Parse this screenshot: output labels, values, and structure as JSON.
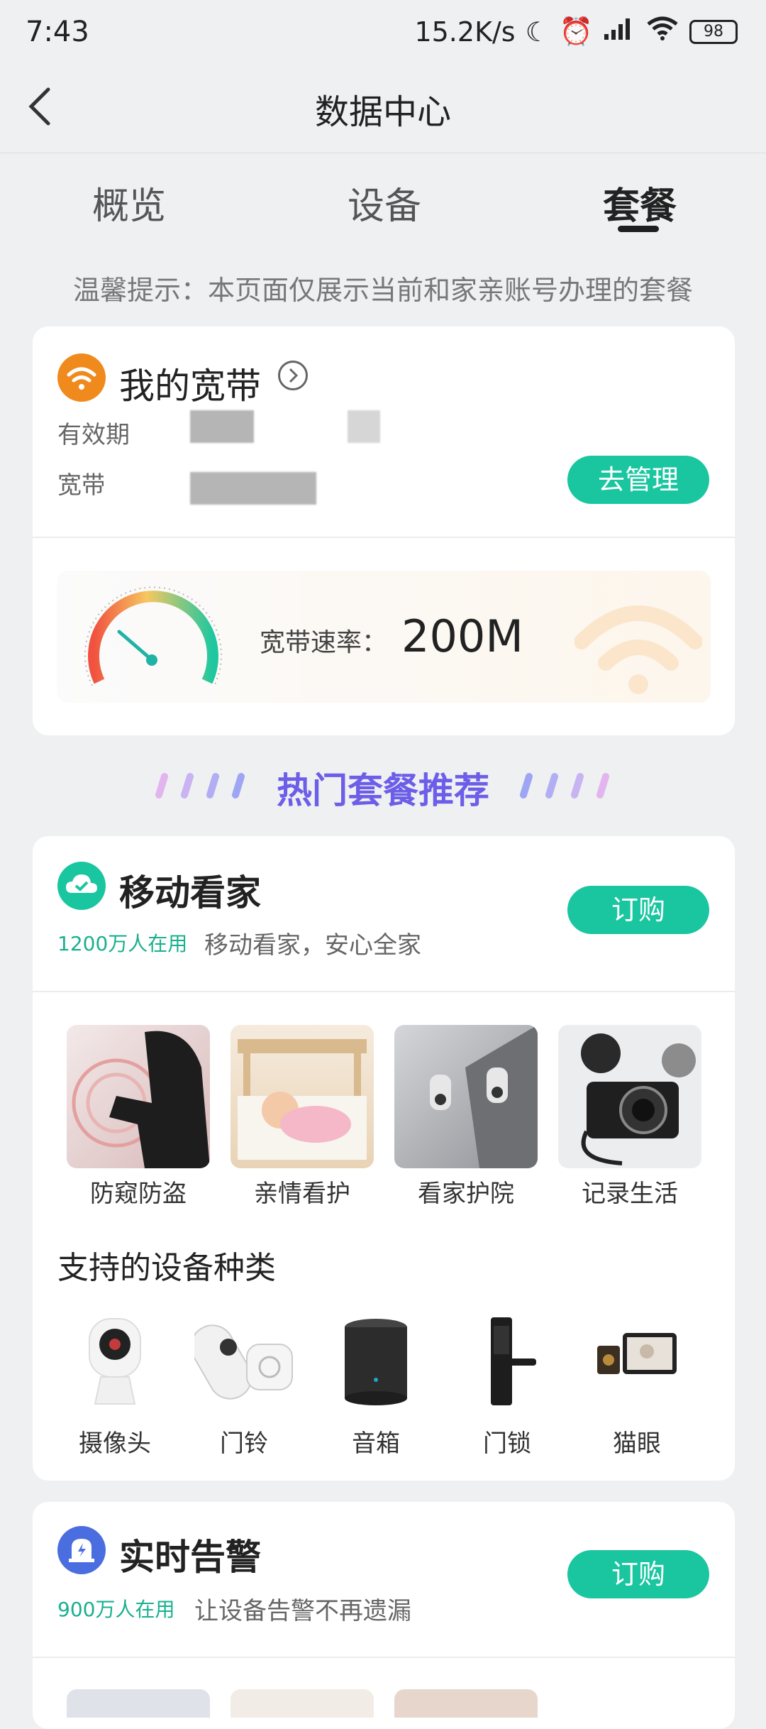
{
  "status_bar": {
    "time": "7:43",
    "network_speed": "15.2K/s",
    "battery": "98",
    "icons": [
      "moon-icon",
      "alarm-icon",
      "signal-icon",
      "wifi-icon",
      "battery-icon"
    ]
  },
  "header": {
    "title": "数据中心"
  },
  "tabs": [
    {
      "label": "概览"
    },
    {
      "label": "设备"
    },
    {
      "label": "套餐",
      "active": true
    }
  ],
  "tip": "温馨提示：本页面仅展示当前和家亲账号办理的套餐",
  "broadband": {
    "title": "我的宽带",
    "validity_label": "有效期",
    "type_label": "宽带",
    "manage_button": "去管理",
    "speed_label": "宽带速率：",
    "speed_value": "200M"
  },
  "recommend_heading": "热门套餐推荐",
  "home_monitor": {
    "title": "移动看家",
    "users": "1200万人在用",
    "slogan": "移动看家，安心全家",
    "order_button": "订购",
    "features": [
      {
        "label": "防窥防盗"
      },
      {
        "label": "亲情看护"
      },
      {
        "label": "看家护院"
      },
      {
        "label": "记录生活"
      }
    ],
    "devices_heading": "支持的设备种类",
    "devices": [
      {
        "label": "摄像头"
      },
      {
        "label": "门铃"
      },
      {
        "label": "音箱"
      },
      {
        "label": "门锁"
      },
      {
        "label": "猫眼"
      }
    ]
  },
  "alarm": {
    "title": "实时告警",
    "users": "900万人在用",
    "slogan": "让设备告警不再遗漏",
    "order_button": "订购"
  },
  "colors": {
    "accent": "#19c6a0",
    "recommend": "#6c5ee8",
    "broadband_icon": "#f08a1c"
  }
}
